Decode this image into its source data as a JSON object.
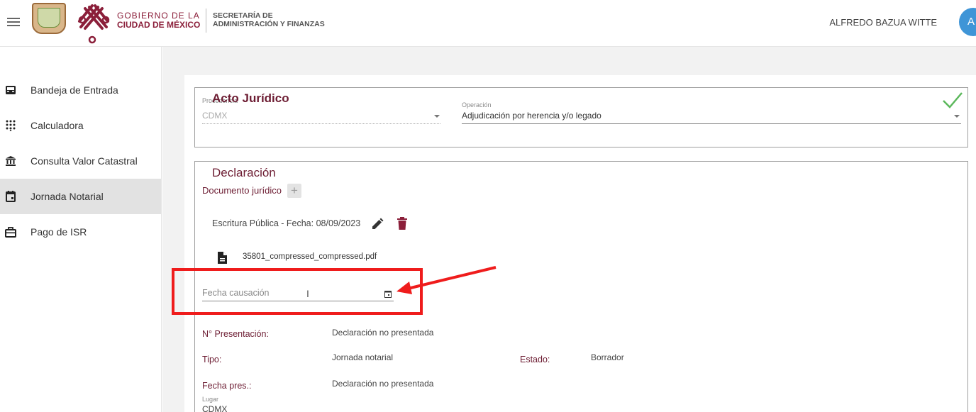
{
  "header": {
    "gov_line1": "GOBIERNO DE LA",
    "gov_line2": "CIUDAD DE MÉXICO",
    "sec_line1": "SECRETARÍA DE",
    "sec_line2": "ADMINISTRACIÓN Y FINANZAS",
    "user_name": "ALFREDO BAZUA WITTE",
    "avatar_initial": "A"
  },
  "sidebar": {
    "items": [
      {
        "label": "Bandeja de Entrada",
        "icon": "inbox-icon"
      },
      {
        "label": "Calculadora",
        "icon": "dialpad-icon"
      },
      {
        "label": "Consulta Valor Catastral",
        "icon": "bank-icon"
      },
      {
        "label": "Jornada Notarial",
        "icon": "calendar-icon",
        "active": true
      },
      {
        "label": "Pago de ISR",
        "icon": "briefcase-icon"
      }
    ]
  },
  "acto": {
    "title": "Acto Jurídico",
    "procedencia_label": "Procedencia",
    "procedencia_value": "CDMX",
    "operacion_label": "Operación",
    "operacion_value": "Adjudicación por herencia y/o legado"
  },
  "declaracion": {
    "title": "Declaración",
    "documento_label": "Documento jurídico",
    "escritura": "Escritura Pública - Fecha: 08/09/2023",
    "file_name": "35801_compressed_compressed.pdf",
    "fecha_causacion_placeholder": "Fecha causación",
    "presentacion_label": "N° Presentación:",
    "presentacion_value": "Declaración no presentada",
    "tipo_label": "Tipo:",
    "tipo_value": "Jornada notarial",
    "estado_label": "Estado:",
    "estado_value": "Borrador",
    "fecha_pres_label": "Fecha pres.:",
    "fecha_pres_value": "Declaración no presentada",
    "lugar_label": "Lugar",
    "lugar_value": "CDMX"
  },
  "colors": {
    "accent": "#6d1d33",
    "annotation": "#ef1c1c",
    "check": "#5cb85c",
    "avatar": "#3f95d7"
  }
}
